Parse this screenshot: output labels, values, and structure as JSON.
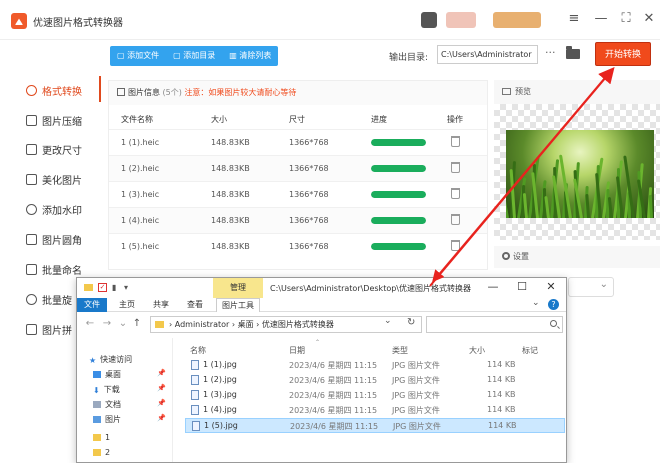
{
  "app": {
    "title": "优速图片格式转换器",
    "window_controls": [
      "≡",
      "—",
      "⛶",
      "✕"
    ]
  },
  "sidebar": {
    "items": [
      {
        "label": "格式转换",
        "active": true
      },
      {
        "label": "图片压缩"
      },
      {
        "label": "更改尺寸"
      },
      {
        "label": "美化图片"
      },
      {
        "label": "添加水印"
      },
      {
        "label": "图片圆角"
      },
      {
        "label": "批量命名"
      },
      {
        "label": "批量旋"
      },
      {
        "label": "图片拼"
      }
    ]
  },
  "toolbar": {
    "add_file": "添加文件",
    "add_folder": "添加目录",
    "clear_list": "清除列表",
    "output_label": "输出目录:",
    "output_path": "C:\\Users\\Administrator",
    "more": "···",
    "start": "开始转换"
  },
  "file_table": {
    "info_label": "图片信息",
    "info_count": "(5个)",
    "info_warn": "注意：如果图片较大请耐心等待",
    "columns": [
      "文件名称",
      "大小",
      "尺寸",
      "进度",
      "操作"
    ],
    "rows": [
      {
        "name": "1 (1).heic",
        "size": "148.83KB",
        "dims": "1366*768",
        "progress": 1.0
      },
      {
        "name": "1 (2).heic",
        "size": "148.83KB",
        "dims": "1366*768",
        "progress": 1.0
      },
      {
        "name": "1 (3).heic",
        "size": "148.83KB",
        "dims": "1366*768",
        "progress": 1.0
      },
      {
        "name": "1 (4).heic",
        "size": "148.83KB",
        "dims": "1366*768",
        "progress": 1.0
      },
      {
        "name": "1 (5).heic",
        "size": "148.83KB",
        "dims": "1366*768",
        "progress": 1.0
      }
    ]
  },
  "preview": {
    "label": "预览",
    "settings_label": "设置"
  },
  "explorer": {
    "manage_tab": "管理",
    "path_title": "C:\\Users\\Administrator\\Desktop\\优速图片格式转换器",
    "ribbon_tabs": [
      "文件",
      "主页",
      "共享",
      "查看",
      "图片工具"
    ],
    "address": [
      "Administrator",
      "桌面",
      "优速图片格式转换器"
    ],
    "nav_items": [
      {
        "label": "快速访问"
      },
      {
        "label": "桌面"
      },
      {
        "label": "下载"
      },
      {
        "label": "文档"
      },
      {
        "label": "图片"
      },
      {
        "label": "1"
      },
      {
        "label": "2"
      }
    ],
    "columns": [
      "名称",
      "日期",
      "类型",
      "大小",
      "标记"
    ],
    "files": [
      {
        "name": "1 (1).jpg",
        "date": "2023/4/6 星期四 11:15",
        "type": "JPG 图片文件",
        "size": "114 KB"
      },
      {
        "name": "1 (2).jpg",
        "date": "2023/4/6 星期四 11:15",
        "type": "JPG 图片文件",
        "size": "114 KB"
      },
      {
        "name": "1 (3).jpg",
        "date": "2023/4/6 星期四 11:15",
        "type": "JPG 图片文件",
        "size": "114 KB"
      },
      {
        "name": "1 (4).jpg",
        "date": "2023/4/6 星期四 11:15",
        "type": "JPG 图片文件",
        "size": "114 KB"
      },
      {
        "name": "1 (5).jpg",
        "date": "2023/4/6 星期四 11:15",
        "type": "JPG 图片文件",
        "size": "114 KB",
        "selected": true
      }
    ]
  },
  "colors": {
    "accent": "#f04a1c",
    "toolbar_blue": "#33a3ee",
    "progress_green": "#1aad5c",
    "annotation_red": "#e8231e"
  }
}
